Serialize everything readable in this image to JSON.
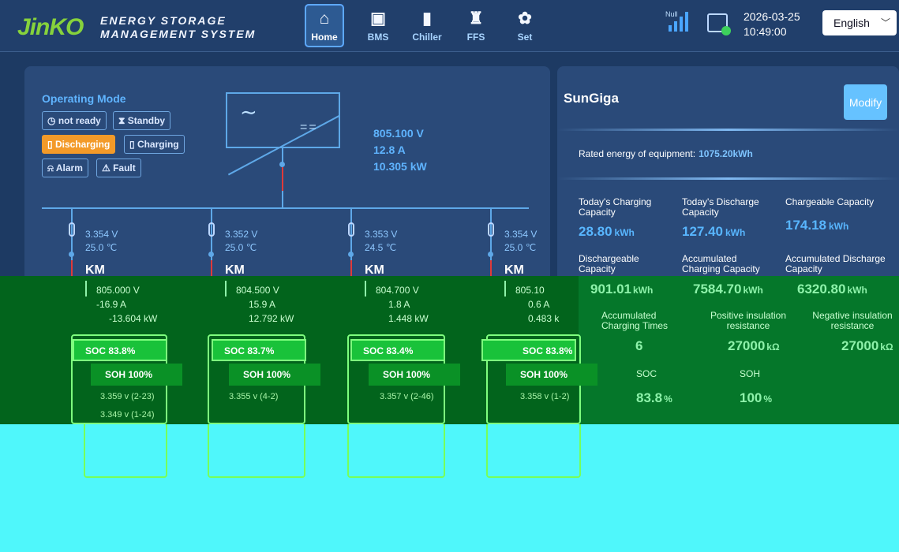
{
  "header": {
    "logo": "JinKO",
    "system_name_line1": "ENERGY STORAGE",
    "system_name_line2": "MANAGEMENT SYSTEM",
    "nav": [
      {
        "label": "Home",
        "icon": "home-icon",
        "active": true
      },
      {
        "label": "BMS",
        "icon": "battery-icon"
      },
      {
        "label": "Chiller",
        "icon": "chiller-icon"
      },
      {
        "label": "FFS",
        "icon": "fire-extinguisher-icon"
      },
      {
        "label": "Set",
        "icon": "gear-icon"
      }
    ],
    "signal_text": "Null",
    "date": "2026-03-25",
    "time": "10:49:00",
    "language": "English"
  },
  "operating": {
    "title": "Operating Mode",
    "modes": [
      "not ready",
      "Standby",
      "Discharging",
      "Charging",
      "Alarm",
      "Fault"
    ],
    "active_mode": "Discharging"
  },
  "inverter": {
    "voltage": "805.100 V",
    "current": "12.8 A",
    "power": "10.305 kW"
  },
  "branches": [
    {
      "cell_v": "3.354 V",
      "temp": "25.0 ℃",
      "km": "KM",
      "dc_v": "805.000 V",
      "dc_a": "-16.9 A",
      "dc_kw": "-13.604 kW",
      "soc": "SOC 83.8%",
      "soh": "SOH 100%",
      "max_v": "3.359 v (2-23)",
      "min_v": "3.349 v (1-24)"
    },
    {
      "cell_v": "3.352 V",
      "temp": "25.0 ℃",
      "km": "KM",
      "dc_v": "804.500 V",
      "dc_a": "15.9 A",
      "dc_kw": "12.792 kW",
      "soc": "SOC 83.7%",
      "soh": "SOH 100%",
      "max_v": "3.355 v (4-2)",
      "min_v": ""
    },
    {
      "cell_v": "3.353 V",
      "temp": "24.5 ℃",
      "km": "KM",
      "dc_v": "804.700 V",
      "dc_a": "1.8 A",
      "dc_kw": "1.448 kW",
      "soc": "SOC 83.4%",
      "soh": "SOH 100%",
      "max_v": "3.357 v (2-46)",
      "min_v": ""
    },
    {
      "cell_v": "3.354 V",
      "temp": "25.0 ℃",
      "km": "KM",
      "dc_v": "805.10",
      "dc_a": "0.6 A",
      "dc_kw": "0.483 k",
      "soc": "SOC 83.8%",
      "soh": "SOH 100%",
      "max_v": "3.358 v (1-2)",
      "min_v": ""
    }
  ],
  "device": {
    "name": "SunGiga",
    "modify_label": "Modify",
    "rated_label": "Rated energy of equipment:",
    "rated_value": "1075.20kWh"
  },
  "stats": [
    {
      "label": "Today's Charging Capacity",
      "value": "28.80",
      "unit": "kWh"
    },
    {
      "label": "Today's Discharge Capacity",
      "value": "127.40",
      "unit": "kWh"
    },
    {
      "label": "Chargeable Capacity",
      "value": "174.18",
      "unit": "kWh"
    },
    {
      "label": "Dischargeable Capacity",
      "value": "901.01",
      "unit": "kWh"
    },
    {
      "label": "Accumulated Charging Capacity",
      "value": "7584.70",
      "unit": "kWh"
    },
    {
      "label": "Accumulated Discharge Capacity",
      "value": "6320.80",
      "unit": "kWh"
    },
    {
      "label": "Accumulated Charging Times",
      "value": "6",
      "unit": ""
    },
    {
      "label": "Positive insulation resistance",
      "value": "27000",
      "unit": "kΩ"
    },
    {
      "label": "Negative insulation resistance",
      "value": "27000",
      "unit": "kΩ"
    },
    {
      "label": "SOC",
      "value": "83.8",
      "unit": "%"
    },
    {
      "label": "SOH",
      "value": "100",
      "unit": "%"
    }
  ]
}
